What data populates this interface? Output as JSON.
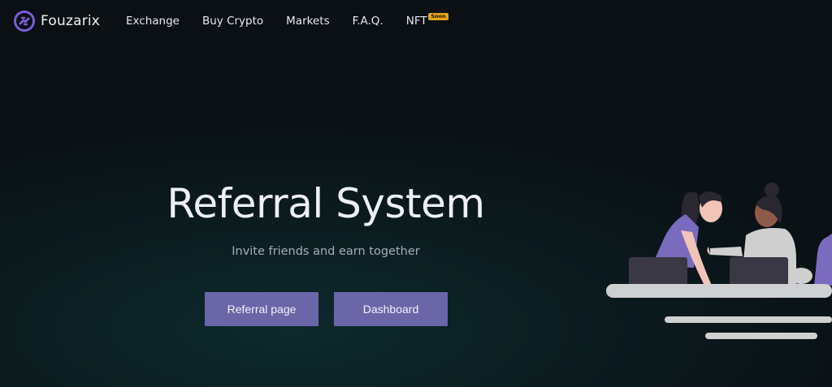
{
  "header": {
    "brand": "Fouzarix",
    "logo_icon": "fouzarix-logo-icon",
    "nav": [
      {
        "label": "Exchange"
      },
      {
        "label": "Buy Crypto"
      },
      {
        "label": "Markets"
      },
      {
        "label": "F.A.Q."
      },
      {
        "label": "NFT",
        "badge": "Soon"
      }
    ]
  },
  "hero": {
    "title": "Referral System",
    "subtitle": "Invite friends and earn together",
    "buttons": {
      "referral": "Referral page",
      "dashboard": "Dashboard"
    }
  },
  "colors": {
    "accent": "#6a66a8",
    "logo": "#7b5cd6",
    "badge": "#e5a41a",
    "background": "#0b1519"
  }
}
